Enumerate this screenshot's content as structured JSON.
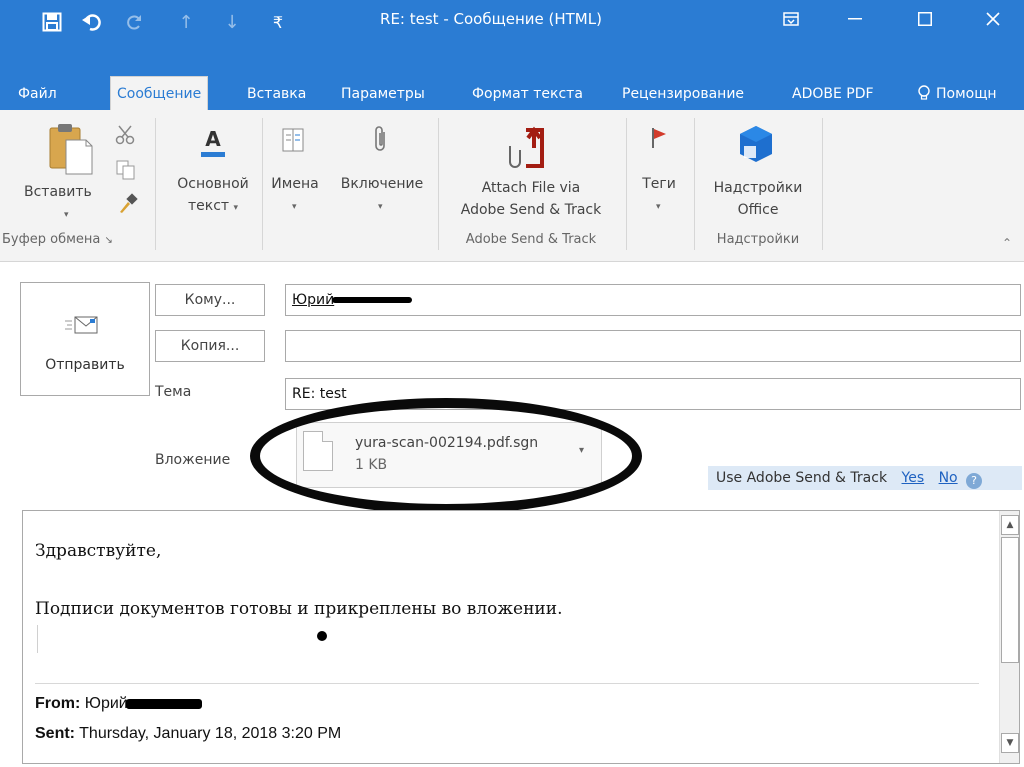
{
  "window": {
    "title": "RE: test  -  Сообщение (HTML)"
  },
  "tabs": [
    {
      "label": "Файл"
    },
    {
      "label": "Сообщение"
    },
    {
      "label": "Вставка"
    },
    {
      "label": "Параметры"
    },
    {
      "label": "Формат текста"
    },
    {
      "label": "Рецензирование"
    },
    {
      "label": "ADOBE PDF"
    },
    {
      "label": "Помощн"
    }
  ],
  "ribbon": {
    "paste_label": "Вставить",
    "basic_text_label_1": "Основной",
    "basic_text_label_2": "текст",
    "names_label": "Имена",
    "include_label": "Включение",
    "attach_label_1": "Attach File via",
    "attach_label_2": "Adobe Send & Track",
    "tags_label": "Теги",
    "addins_label_1": "Надстройки",
    "addins_label_2": "Office",
    "groups": {
      "clipboard": "Буфер обмена",
      "adobe": "Adobe Send & Track",
      "addins": "Надстройки"
    }
  },
  "compose": {
    "send_label": "Отправить",
    "to_button": "Кому...",
    "cc_button": "Копия...",
    "subject_label": "Тема",
    "attachment_label": "Вложение",
    "to_value": "Юрий",
    "cc_value": "",
    "subject_value": "RE: test",
    "attachment": {
      "filename": "yura-scan-002194.pdf.sgn",
      "size": "1 KB"
    },
    "send_track": {
      "text": "Use Adobe Send & Track",
      "yes": "Yes",
      "no": "No",
      "help": "?"
    }
  },
  "body": {
    "greeting": "Здравствуйте,",
    "message": "Подписи документов готовы и прикреплены во вложении.",
    "from_label": "From:",
    "from_value": "Юрий",
    "sent_label": "Sent:",
    "sent_value": "Thursday, January 18, 2018 3:20 PM"
  },
  "colors": {
    "title_bar": "#2b7cd3",
    "ribbon_bg": "#f3f3f3",
    "link": "#1f62c1",
    "send_track_bg": "#dde9f6"
  }
}
